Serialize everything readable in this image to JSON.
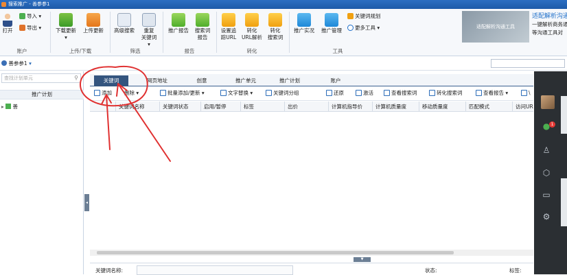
{
  "window": {
    "title": "搜索推广 - 善参参1"
  },
  "ribbon": {
    "open": "打开",
    "import": "导入",
    "export": "导出",
    "download_update": "下载更新",
    "upload_update": "上传更新",
    "advanced_search": "高级搜索",
    "dup_keywords_1": "重复",
    "dup_keywords_2": "关键词",
    "promo_report": "推广报告",
    "search_word_report_1": "搜索词",
    "search_word_report_2": "报告",
    "set_tracking_1": "设置追",
    "set_tracking_2": "踪URL",
    "convert_url_1": "转化",
    "convert_url_2": "URL解析",
    "convert_search_1": "转化",
    "convert_search_2": "搜索词",
    "promo_status": "推广实况",
    "promo_manage": "推广管理",
    "keyword_planner": "关键词规划",
    "more_tools": "更多工具",
    "groups": {
      "account": "账户",
      "upload_download": "上传/下载",
      "filter": "筛选",
      "report": "报告",
      "convert": "转化",
      "tools": "工具"
    }
  },
  "ad": {
    "banner": "适配解析沟通工具",
    "title": "适配解析沟通",
    "line1": "一键解析商务通",
    "line2": "等沟通工具对"
  },
  "account": {
    "name": "善参参1"
  },
  "left": {
    "search_placeholder": "查找计划单元",
    "header": "推广计划",
    "tree_root": "善"
  },
  "tabs": [
    "关键词",
    "网页地址",
    "创意",
    "推广单元",
    "推广计划",
    "账户"
  ],
  "toolbar": {
    "add": "添加",
    "delete": "删除",
    "bulk_add": "批量添加/更新",
    "text_replace": "文字替换",
    "keyword_group": "关键词分组",
    "restore": "还原",
    "activate": "激活",
    "view_search_words": "查看搜索词",
    "convert_search_words": "转化搜索词",
    "view_report": "查看报告",
    "more": "\\"
  },
  "grid": {
    "columns": [
      "关键词名称",
      "关键词状态",
      "启用/暂停",
      "标签",
      "出价",
      "计算机指导价",
      "计算机质量度",
      "移动质量度",
      "匹配模式",
      "访问UR"
    ]
  },
  "detail": {
    "keyword_name_label": "关键词名称:",
    "status_label": "状态:",
    "tag_label": "标签:"
  },
  "rightbar": {
    "badge": "1"
  },
  "colors": {
    "accent": "#34557f",
    "title": "#1d5aa8",
    "annotation": "#e03030"
  }
}
